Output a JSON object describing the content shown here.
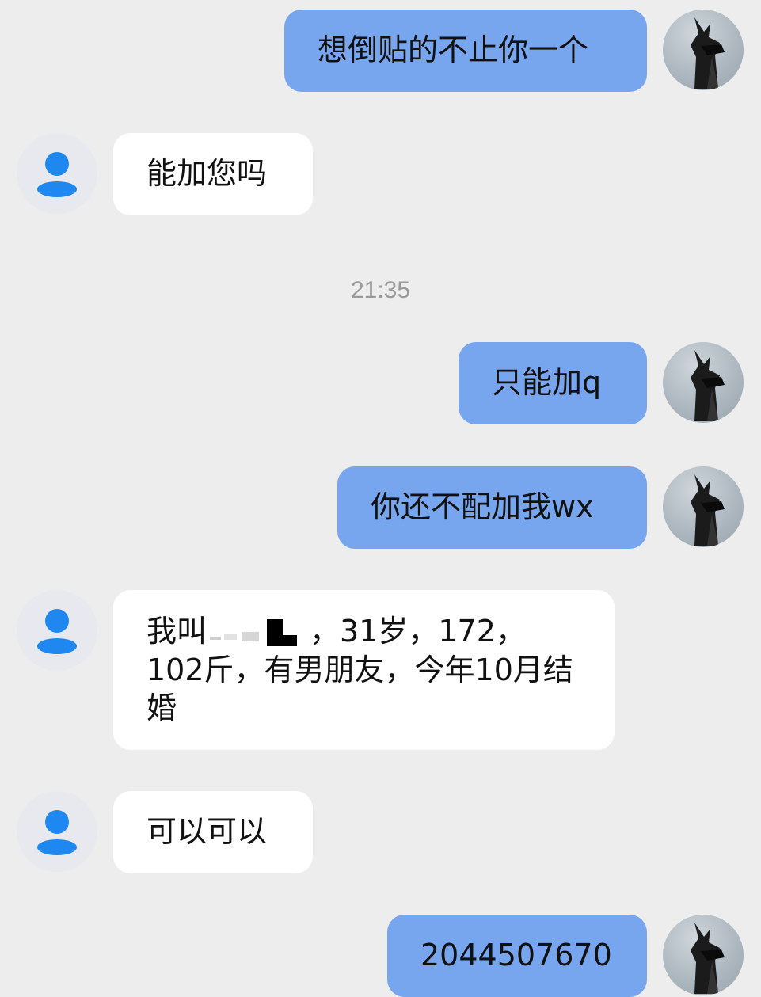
{
  "timestamp": "21:35",
  "messages": [
    {
      "sender": "self",
      "text": "想倒贴的不止你一个"
    },
    {
      "sender": "peer",
      "text": "能加您吗"
    },
    {
      "sender": "self",
      "text": "只能加q"
    },
    {
      "sender": "self",
      "text": "你还不配加我wx"
    },
    {
      "sender": "peer",
      "text_before": "我叫",
      "text_after": "，31岁，172，102斤，有男朋友，今年10月结婚"
    },
    {
      "sender": "peer",
      "text": "可以可以"
    },
    {
      "sender": "self",
      "text": "2044507670"
    }
  ],
  "colors": {
    "background": "#ededed",
    "self_bubble": "#77a6ef",
    "peer_bubble": "#ffffff",
    "peer_avatar_icon": "#1e88f0"
  },
  "icons": {
    "peer_avatar": "default-user-icon",
    "self_avatar": "dark-character-avatar"
  }
}
